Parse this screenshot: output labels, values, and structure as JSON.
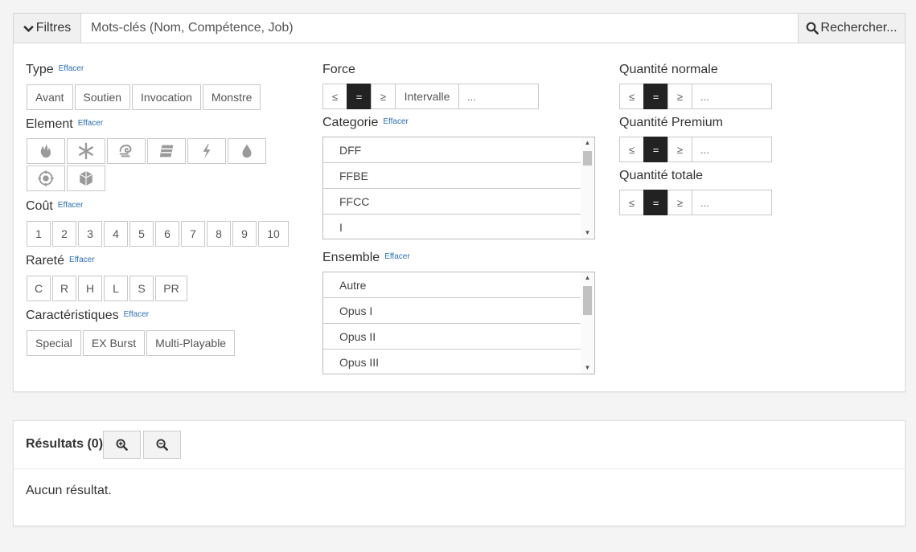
{
  "search": {
    "filters_label": "Filtres",
    "placeholder": "Mots-clés (Nom, Compétence, Job)",
    "search_label": "Rechercher..."
  },
  "filters": {
    "clear_label": "Effacer",
    "type": {
      "label": "Type",
      "options": [
        "Avant",
        "Soutien",
        "Invocation",
        "Monstre"
      ]
    },
    "element": {
      "label": "Element",
      "icons": [
        "fire-icon",
        "ice-icon",
        "wind-icon",
        "earth-icon",
        "lightning-icon",
        "water-icon",
        "light-icon",
        "dark-icon"
      ]
    },
    "cost": {
      "label": "Coût",
      "options": [
        "1",
        "2",
        "3",
        "4",
        "5",
        "6",
        "7",
        "8",
        "9",
        "10"
      ]
    },
    "rarity": {
      "label": "Rareté",
      "options": [
        "C",
        "R",
        "H",
        "L",
        "S",
        "PR"
      ]
    },
    "traits": {
      "label": "Caractéristiques",
      "options": [
        "Special",
        "EX Burst",
        "Multi-Playable"
      ]
    },
    "power": {
      "label": "Force",
      "ops": [
        "≤",
        "=",
        "≥"
      ],
      "range_label": "Intervalle",
      "input_placeholder": "..."
    },
    "category": {
      "label": "Categorie",
      "items": [
        "DFF",
        "FFBE",
        "FFCC",
        "I"
      ]
    },
    "set": {
      "label": "Ensemble",
      "items": [
        "Autre",
        "Opus I",
        "Opus II",
        "Opus III"
      ]
    },
    "qty_normal": {
      "label": "Quantité normale",
      "ops": [
        "≤",
        "=",
        "≥"
      ],
      "input_placeholder": "..."
    },
    "qty_premium": {
      "label": "Quantité Premium",
      "ops": [
        "≤",
        "=",
        "≥"
      ],
      "input_placeholder": "..."
    },
    "qty_total": {
      "label": "Quantité totale",
      "ops": [
        "≤",
        "=",
        "≥"
      ],
      "input_placeholder": "..."
    }
  },
  "results": {
    "title": "Résultats (0)",
    "empty_text": "Aucun résultat."
  }
}
